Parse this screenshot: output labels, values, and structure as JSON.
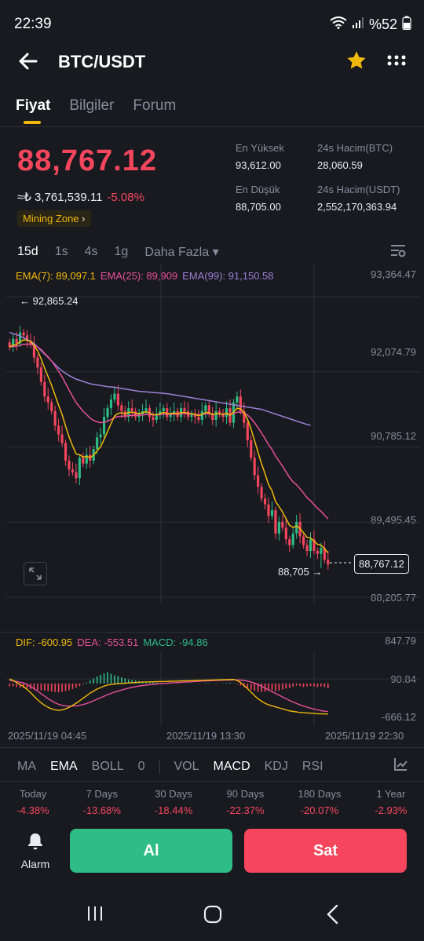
{
  "status": {
    "time": "22:39",
    "battery": "%52"
  },
  "header": {
    "title": "BTC/USDT"
  },
  "tabs": [
    {
      "label": "Fiyat"
    },
    {
      "label": "Bilgiler"
    },
    {
      "label": "Forum"
    }
  ],
  "ticker": {
    "last_price": "88,767.12",
    "try_price": "≈₺ 3,761,539.11",
    "change": "-5.08%",
    "zone": "Mining Zone",
    "high_label": "En Yüksek",
    "high": "93,612.00",
    "low_label": "En Düşük",
    "low": "88,705.00",
    "vol_btc_label": "24s Hacim(BTC)",
    "vol_btc": "28,060.59",
    "vol_usdt_label": "24s Hacim(USDT)",
    "vol_usdt": "2,552,170,363.94"
  },
  "intervals": [
    "15d",
    "1s",
    "4s",
    "1g",
    "Daha Fazla"
  ],
  "ema_legend": {
    "ema7": "EMA(7): 89,097.1",
    "ema25": "EMA(25): 89,909",
    "ema99": "EMA(99): 91,150.58"
  },
  "price_axis": [
    "93,364.47",
    "92,074.79",
    "90,785.12",
    "89,495.45",
    "88,205.77"
  ],
  "chart_annotations": {
    "high_marker": "92,865.24",
    "low_marker": "88,705",
    "last_price_tag": "88,767.12"
  },
  "macd_legend": {
    "dif": "DIF: -600.95",
    "dea": "DEA: -553.51",
    "macd": "MACD: -94.86"
  },
  "macd_axis": [
    "847.79",
    "90.84",
    "-666.12"
  ],
  "time_axis": [
    "2025/11/19 04:45",
    "2025/11/19 13:30",
    "2025/11/19 22:30"
  ],
  "indicators": [
    "MA",
    "EMA",
    "BOLL",
    "0",
    "VOL",
    "MACD",
    "KDJ",
    "RSI"
  ],
  "performance": [
    {
      "label": "Today",
      "value": "-4.38%"
    },
    {
      "label": "7 Days",
      "value": "-13.68%"
    },
    {
      "label": "30 Days",
      "value": "-18.44%"
    },
    {
      "label": "90 Days",
      "value": "-22.37%"
    },
    {
      "label": "180 Days",
      "value": "-20.07%"
    },
    {
      "label": "1 Year",
      "value": "-2.93%"
    }
  ],
  "actions": {
    "alarm": "Alarm",
    "buy": "Al",
    "sell": "Sat"
  },
  "colors": {
    "up": "#2ebd85",
    "down": "#f6465d",
    "accent": "#f0b90b",
    "ema7": "#f0b90b",
    "ema25": "#e84f9a",
    "ema99": "#9b7fd4",
    "background": "#181a20"
  },
  "chart_data": {
    "type": "candlestick",
    "ylim": [
      88205.77,
      93364.47
    ],
    "y_ticks": [
      93364.47,
      92074.79,
      90785.12,
      89495.45,
      88205.77
    ],
    "high": 92865.24,
    "low": 88705,
    "last": 88767.12,
    "closes": [
      92500,
      92640,
      92560,
      92750,
      92700,
      92610,
      92540,
      92320,
      92150,
      91900,
      91650,
      91550,
      91400,
      91150,
      91000,
      90850,
      90550,
      90400,
      90350,
      90250,
      90600,
      90500,
      90650,
      90550,
      90750,
      90950,
      91000,
      91300,
      91450,
      91600,
      91700,
      91500,
      91400,
      91300,
      91450,
      91400,
      91300,
      91350,
      91400,
      91450,
      91300,
      91250,
      91350,
      91400,
      91450,
      91300,
      91350,
      91400,
      91300,
      91450,
      91400,
      91300,
      91350,
      91300,
      91250,
      91400,
      91500,
      91350,
      91250,
      91400,
      91350,
      91300,
      91450,
      91200,
      91550,
      91650,
      91400,
      91200,
      90900,
      90600,
      90300,
      90100,
      89900,
      89800,
      89600,
      89700,
      89300,
      89500,
      89400,
      89200,
      89100,
      89300,
      89500,
      89250,
      89100,
      89000,
      89200,
      89000,
      88950,
      89050,
      88850,
      88767
    ],
    "ema7": [
      92500,
      92535,
      92541,
      92593,
      92620,
      92617,
      92598,
      92529,
      92434,
      92301,
      92138,
      91991,
      91843,
      91670,
      91503,
      91340,
      91143,
      90957,
      90805,
      90666,
      90650,
      90612,
      90622,
      90604,
      90641,
      90718,
      90788,
      90916,
      91050,
      91188,
      91316,
      91362,
      91372,
      91354,
      91378,
      91383,
      91363,
      91360,
      91370,
      91390,
      91367,
      91338,
      91341,
      91356,
      91379,
      91359,
      91357,
      91368,
      91351,
      91376,
      91382,
      91362,
      91359,
      91344,
      91321,
      91341,
      91381,
      91373,
      91342,
      91357,
      91355,
      91341,
      91368,
      91326,
      91382,
      91449,
      91437,
      91377,
      91258,
      91093,
      90895,
      90696,
      90497,
      90323,
      90142,
      90032,
      89849,
      89762,
      89671,
      89553,
      89440,
      89405,
      89429,
      89384,
      89313,
      89235,
      89226,
      89170,
      89115,
      89099,
      89037,
      88970
    ],
    "ema25": [
      92500,
      92511,
      92514,
      92532,
      92546,
      92550,
      92549,
      92531,
      92502,
      92456,
      92394,
      92330,
      92258,
      92173,
      92083,
      91987,
      91876,
      91763,
      91654,
      91546,
      91473,
      91398,
      91342,
      91281,
      91240,
      91218,
      91201,
      91209,
      91227,
      91256,
      91290,
      91306,
      91313,
      91312,
      91323,
      91329,
      91327,
      91329,
      91334,
      91343,
      91340,
      91333,
      91335,
      91340,
      91349,
      91345,
      91345,
      91349,
      91345,
      91353,
      91357,
      91352,
      91351,
      91346,
      91339,
      91344,
      91356,
      91355,
      91347,
      91351,
      91351,
      91347,
      91355,
      91343,
      91359,
      91382,
      91383,
      91369,
      91333,
      91276,
      91201,
      91116,
      91022,
      90928,
      90826,
      90740,
      90630,
      90543,
      90455,
      90358,
      90261,
      90187,
      90134,
      90067,
      89993,
      89917,
      89862,
      89796,
      89731,
      89679,
      89615,
      89550
    ],
    "ema99": [
      92750,
      92730,
      92710,
      92690,
      92660,
      92630,
      92600,
      92560,
      92500,
      92440,
      92380,
      92320,
      92260,
      92200,
      92140,
      92090,
      92050,
      92010,
      91980,
      91950,
      91930,
      91910,
      91890,
      91870,
      91860,
      91850,
      91840,
      91830,
      91820,
      91815,
      91810,
      91800,
      91790,
      91780,
      91770,
      91760,
      91750,
      91740,
      91735,
      91730,
      91725,
      91720,
      91715,
      91710,
      91705,
      91700,
      91690,
      91680,
      91670,
      91660,
      91650,
      91640,
      91630,
      91620,
      91610,
      91600,
      91590,
      91580,
      91570,
      91560,
      91550,
      91540,
      91530,
      91520,
      91510,
      91500,
      91490,
      91480,
      91470,
      91460,
      91450,
      91440,
      91430,
      91410,
      91390,
      91370,
      91350,
      91330,
      91310,
      91290,
      91270,
      91250,
      91230,
      91210,
      91190,
      91170,
      91160,
      91150,
      91150,
      91150,
      91150,
      91150
    ],
    "macd": {
      "ylim": [
        -666.12,
        847.79
      ],
      "hist": [
        -60,
        -55,
        -70,
        -80,
        -90,
        -100,
        -110,
        -120,
        -130,
        -135,
        -140,
        -150,
        -160,
        -170,
        -175,
        -165,
        -150,
        -130,
        -110,
        -80,
        -50,
        -20,
        20,
        60,
        100,
        140,
        170,
        200,
        220,
        190,
        160,
        150,
        120,
        100,
        80,
        70,
        60,
        50,
        40,
        30,
        25,
        20,
        15,
        10,
        10,
        5,
        5,
        0,
        -5,
        -5,
        0,
        5,
        5,
        0,
        -5,
        0,
        10,
        5,
        0,
        -5,
        0,
        5,
        10,
        15,
        5,
        -10,
        -40,
        -70,
        -100,
        -120,
        -140,
        -160,
        -170,
        -160,
        -140,
        -130,
        -150,
        -140,
        -120,
        -100,
        -90,
        -60,
        -40,
        -50,
        -70,
        -60,
        -50,
        -60,
        -70,
        -60,
        -70,
        -94.86
      ],
      "dif": [
        90,
        60,
        20,
        -20,
        -60,
        -120,
        -180,
        -250,
        -320,
        -380,
        -430,
        -470,
        -500,
        -520,
        -530,
        -520,
        -500,
        -470,
        -430,
        -390,
        -340,
        -290,
        -240,
        -190,
        -150,
        -110,
        -80,
        -50,
        -30,
        -20,
        -10,
        -5,
        0,
        5,
        10,
        15,
        20,
        25,
        28,
        30,
        32,
        34,
        36,
        38,
        40,
        42,
        44,
        46,
        48,
        50,
        52,
        54,
        56,
        58,
        60,
        62,
        64,
        66,
        68,
        70,
        72,
        74,
        76,
        78,
        80,
        60,
        20,
        -40,
        -100,
        -170,
        -240,
        -300,
        -350,
        -390,
        -420,
        -440,
        -460,
        -480,
        -500,
        -520,
        -540,
        -550,
        -560,
        -570,
        -575,
        -580,
        -585,
        -590,
        -595,
        -598,
        -600,
        -600.95
      ],
      "dea": [
        60,
        50,
        40,
        25,
        10,
        -20,
        -60,
        -100,
        -150,
        -200,
        -250,
        -300,
        -340,
        -380,
        -410,
        -430,
        -440,
        -445,
        -445,
        -440,
        -430,
        -415,
        -395,
        -370,
        -340,
        -310,
        -280,
        -250,
        -220,
        -195,
        -170,
        -150,
        -130,
        -110,
        -92,
        -76,
        -62,
        -50,
        -40,
        -32,
        -24,
        -17,
        -10,
        -4,
        1,
        6,
        11,
        15,
        19,
        23,
        27,
        31,
        35,
        39,
        43,
        47,
        51,
        54,
        57,
        60,
        62,
        64,
        66,
        68,
        70,
        70,
        68,
        60,
        48,
        30,
        8,
        -20,
        -55,
        -90,
        -125,
        -160,
        -195,
        -230,
        -265,
        -300,
        -335,
        -365,
        -395,
        -420,
        -445,
        -465,
        -485,
        -505,
        -520,
        -535,
        -545,
        -553.51
      ]
    }
  }
}
